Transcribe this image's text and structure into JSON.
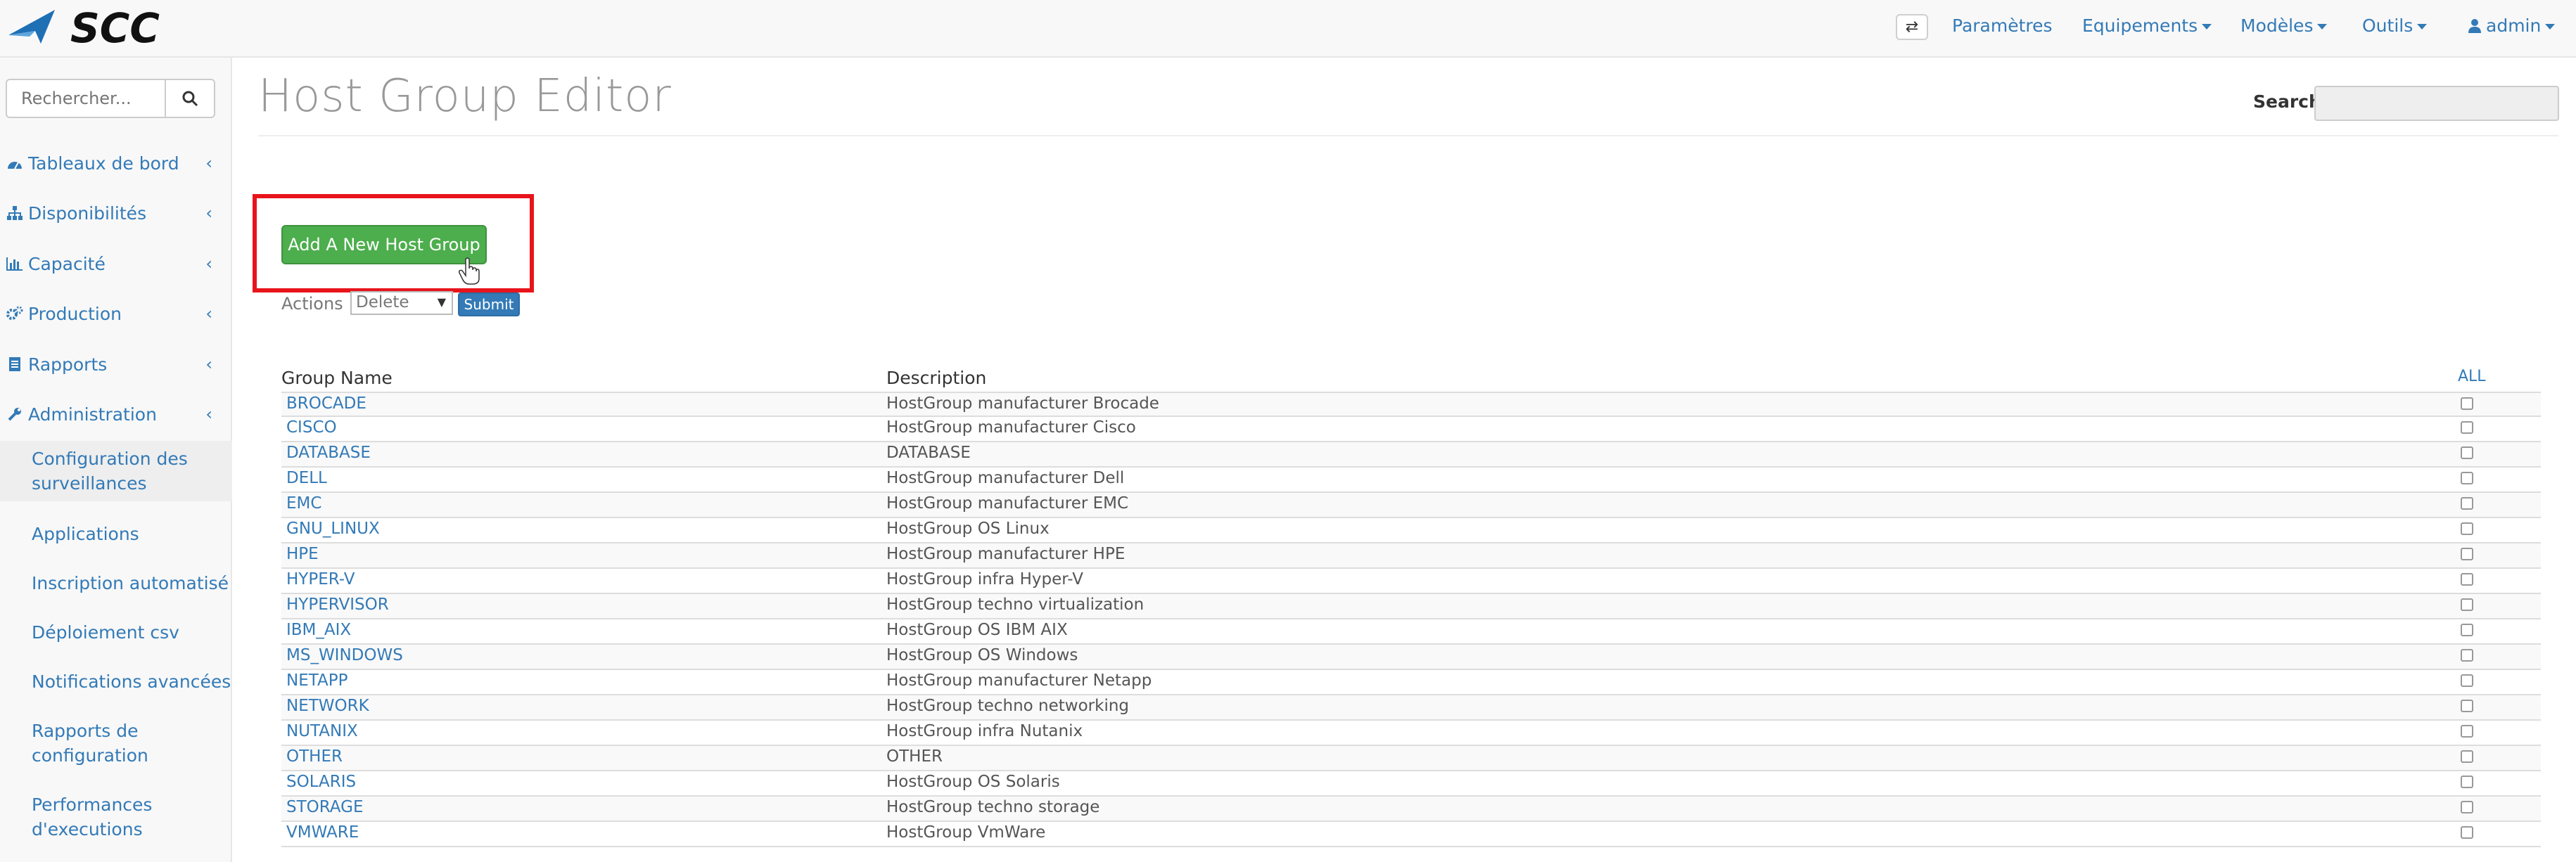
{
  "navbar": {
    "items": [
      {
        "label": "Paramètres",
        "dropdown": false
      },
      {
        "label": "Equipements",
        "dropdown": true
      },
      {
        "label": "Modèles",
        "dropdown": true
      },
      {
        "label": "Outils",
        "dropdown": true
      },
      {
        "label": "admin",
        "dropdown": true
      }
    ],
    "accent": "#337ab7"
  },
  "sidebar": {
    "search_placeholder": "Rechercher...",
    "menu": [
      {
        "label": "Tableaux de bord",
        "icon": "dashboard-icon"
      },
      {
        "label": "Disponibilités",
        "icon": "sitemap-icon"
      },
      {
        "label": "Capacité",
        "icon": "bar-chart-icon"
      },
      {
        "label": "Production",
        "icon": "gears-icon"
      },
      {
        "label": "Rapports",
        "icon": "file-icon"
      },
      {
        "label": "Administration",
        "icon": "wrench-icon"
      }
    ],
    "submenu": [
      {
        "label": "Configuration des surveillances"
      },
      {
        "label": "Applications"
      },
      {
        "label": "Inscription automatisé"
      },
      {
        "label": "Déploiement csv"
      },
      {
        "label": "Notifications avancées"
      },
      {
        "label": "Rapports de configuration"
      },
      {
        "label": "Performances d'executions"
      }
    ]
  },
  "main": {
    "title": "Host Group Editor",
    "search_label": "Search:",
    "add_button": "Add A New Host Group",
    "actions_label": "Actions :",
    "actions_selected": "Delete",
    "submit_label": "Submit",
    "table": {
      "headers": {
        "name": "Group Name",
        "description": "Description",
        "all": "ALL"
      },
      "rows": [
        {
          "name": "BROCADE",
          "description": "HostGroup manufacturer Brocade"
        },
        {
          "name": "CISCO",
          "description": "HostGroup manufacturer Cisco"
        },
        {
          "name": "DATABASE",
          "description": "DATABASE"
        },
        {
          "name": "DELL",
          "description": "HostGroup manufacturer Dell"
        },
        {
          "name": "EMC",
          "description": "HostGroup manufacturer EMC"
        },
        {
          "name": "GNU_LINUX",
          "description": "HostGroup OS Linux"
        },
        {
          "name": "HPE",
          "description": "HostGroup manufacturer HPE"
        },
        {
          "name": "HYPER-V",
          "description": "HostGroup infra Hyper-V"
        },
        {
          "name": "HYPERVISOR",
          "description": "HostGroup techno virtualization"
        },
        {
          "name": "IBM_AIX",
          "description": "HostGroup OS IBM AIX"
        },
        {
          "name": "MS_WINDOWS",
          "description": "HostGroup OS Windows"
        },
        {
          "name": "NETAPP",
          "description": "HostGroup manufacturer Netapp"
        },
        {
          "name": "NETWORK",
          "description": "HostGroup techno networking"
        },
        {
          "name": "NUTANIX",
          "description": "HostGroup infra Nutanix"
        },
        {
          "name": "OTHER",
          "description": "OTHER"
        },
        {
          "name": "SOLARIS",
          "description": "HostGroup OS Solaris"
        },
        {
          "name": "STORAGE",
          "description": "HostGroup techno storage"
        },
        {
          "name": "VMWARE",
          "description": "HostGroup VmWare"
        }
      ]
    }
  },
  "logo": {
    "text": "SCC"
  },
  "colors": {
    "add_button": "#4cae4c",
    "highlight": "#e8141c",
    "submit": "#337ab7"
  }
}
